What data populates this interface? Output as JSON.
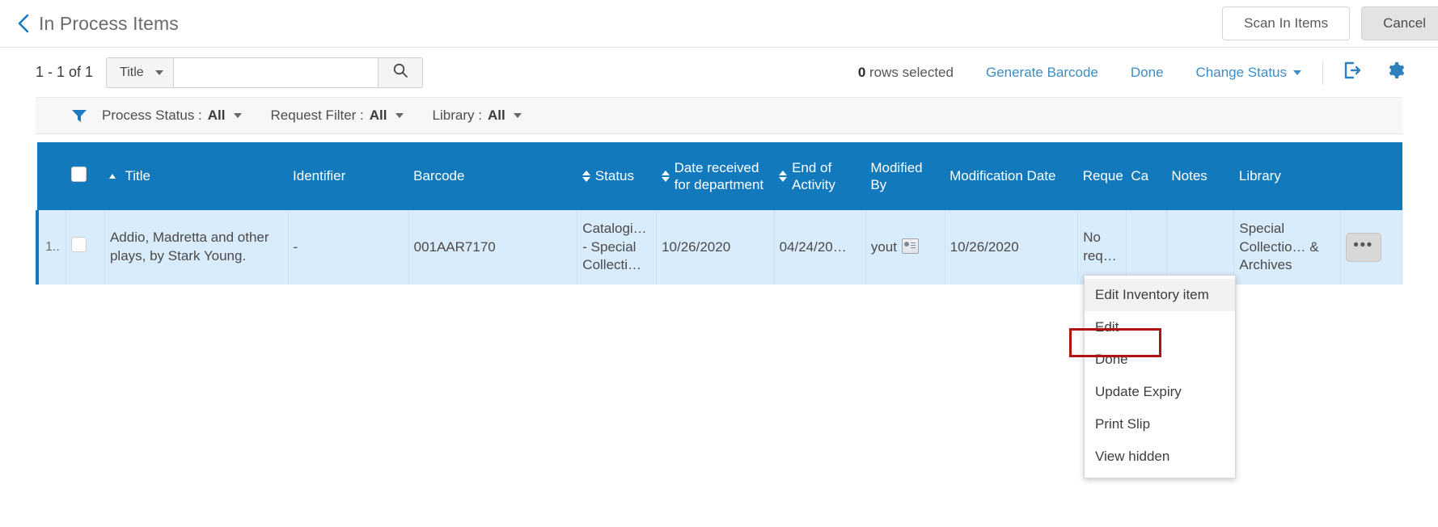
{
  "header": {
    "back_icon": "chevron-left-icon",
    "title": "In Process Items",
    "scan_in_label": "Scan In Items",
    "cancel_label": "Cancel"
  },
  "toolbar": {
    "count": "1 - 1 of 1",
    "search_field": "Title",
    "search_value": "",
    "search_placeholder": "",
    "search_icon": "search-icon",
    "rows_selected_number": "0",
    "rows_selected_label": " rows selected",
    "generate_barcode": "Generate Barcode",
    "done": "Done",
    "change_status": "Change Status",
    "export_icon": "export-icon",
    "settings_icon": "gear-icon"
  },
  "filters": {
    "funnel_icon": "filter-funnel-icon",
    "items": [
      {
        "label": "Process Status :",
        "value": "All"
      },
      {
        "label": "Request Filter :",
        "value": "All"
      },
      {
        "label": "Library :",
        "value": "All"
      }
    ]
  },
  "table": {
    "columns": [
      {
        "label": "Title",
        "sort": "asc"
      },
      {
        "label": "Identifier",
        "sort": "none"
      },
      {
        "label": "Barcode",
        "sort": "none"
      },
      {
        "label": "Status",
        "sort": "both"
      },
      {
        "label": "Date received for department",
        "sort": "both"
      },
      {
        "label": "End of Activity",
        "sort": "both"
      },
      {
        "label": "Modified By",
        "sort": "none"
      },
      {
        "label": "Modification Date",
        "sort": "none"
      },
      {
        "label": "Reque",
        "sort": "none"
      },
      {
        "label": "Ca",
        "sort": "none"
      },
      {
        "label": "Notes",
        "sort": "none"
      },
      {
        "label": "Library",
        "sort": "none"
      }
    ],
    "rows": [
      {
        "index": "1..",
        "title": "Addio, Madretta and other plays, by Stark Young.",
        "identifier": "-",
        "barcode": "001AAR7170",
        "status": "Catalogi… - Special Collecti…",
        "date_received": "10/26/2020",
        "end_of_activity": "04/24/20…",
        "modified_by": "yout",
        "modified_by_icon": "contact-card-icon",
        "modification_date": "10/26/2020",
        "request": "No req…",
        "call": "",
        "notes": "",
        "library": "Special Collectio… & Archives",
        "actions_label": "•••"
      }
    ]
  },
  "context_menu": {
    "items": [
      "Edit Inventory item",
      "Edit",
      "Done",
      "Update Expiry",
      "Print Slip",
      "View hidden"
    ],
    "hovered_index": 0,
    "highlighted_index": 2,
    "highlight_color": "#b11212"
  },
  "colors": {
    "header_blue": "#1279bd",
    "row_blue": "#d9ecfb",
    "link_blue": "#3c8dc5"
  }
}
